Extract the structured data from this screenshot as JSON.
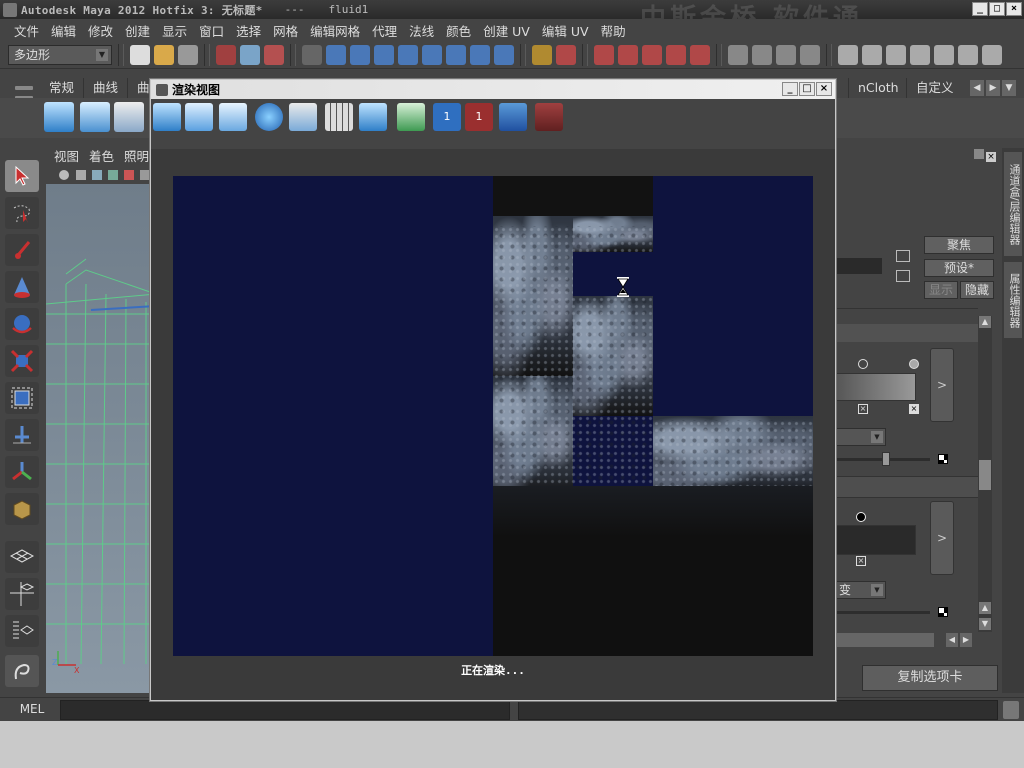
{
  "titlebar": {
    "title": "Autodesk Maya 2012 Hotfix 3: 无标题*",
    "separator": "---",
    "scene": "fluid1",
    "watermark": "中斯金桥 软件通"
  },
  "menubar": {
    "items": [
      "文件",
      "编辑",
      "修改",
      "创建",
      "显示",
      "窗口",
      "选择",
      "网格",
      "编辑网格",
      "代理",
      "法线",
      "颜色",
      "创建 UV",
      "编辑 UV",
      "帮助"
    ]
  },
  "statusline": {
    "mode_menu": "多边形"
  },
  "shelf": {
    "tabs": [
      "常规",
      "曲线",
      "曲面"
    ],
    "right_tabs": [
      "nCloth",
      "自定义"
    ]
  },
  "viewport": {
    "menu": [
      "视图",
      "着色",
      "照明"
    ]
  },
  "attribute_editor": {
    "side_tabs": [
      "通道盒/层编辑器",
      "属性编辑器"
    ],
    "focus_button": "聚焦",
    "presets_button": "预设*",
    "show_button": "显示",
    "hide_button": "隐藏",
    "interpolation_combo": "",
    "gradient_combo": "变",
    "ramp_expand": ">",
    "copy_tab_button": "复制选项卡"
  },
  "render_view": {
    "title": "渲染视图",
    "status": "正在渲染..."
  },
  "command_line": {
    "label": "MEL",
    "value": ""
  },
  "colors": {
    "canvas_background": "#0e133e",
    "ui_background": "#444444",
    "help_line": "#c9c9c9"
  },
  "icons": {
    "titlebar": "maya-logo-icon",
    "render_view": "render-view-icon",
    "progress": "hourglass-icon"
  }
}
